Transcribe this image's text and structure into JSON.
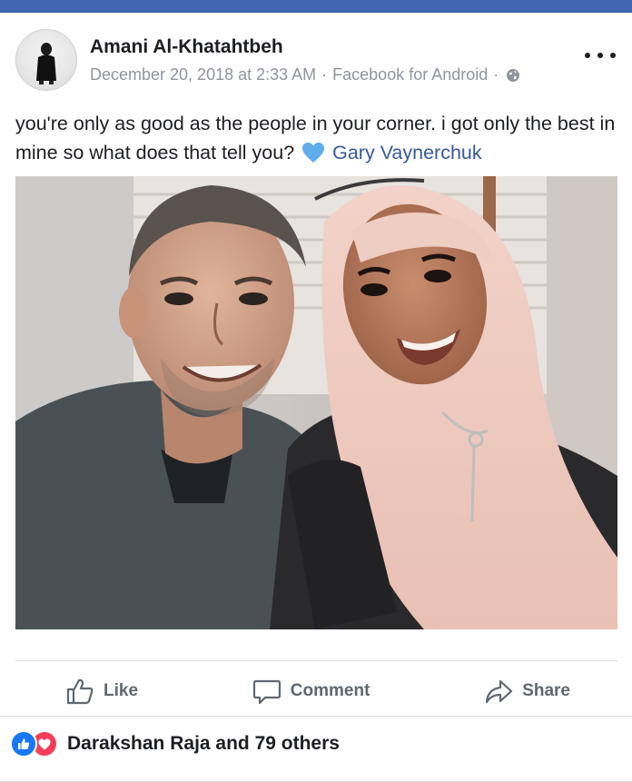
{
  "post": {
    "author": "Amani Al-Khatahtbeh",
    "timestamp": "December 20, 2018 at 2:33 AM",
    "separator": "·",
    "source": "Facebook for Android",
    "privacy_icon": "globe-icon",
    "text": "you're only as good as the people in your corner. i got only the best in mine so what does that tell you?",
    "emoji_icon": "blue-heart-icon",
    "mention": "Gary Vaynerchuk"
  },
  "actions": {
    "like_label": "Like",
    "comment_label": "Comment",
    "share_label": "Share"
  },
  "reactions": {
    "icons": [
      "like-reaction-icon",
      "love-reaction-icon"
    ],
    "summary": "Darakshan Raja and 79 others"
  },
  "colors": {
    "top_bar": "#4267b2",
    "link": "#385898",
    "meta_text": "#90949c",
    "like_reaction": "#1877f2",
    "love_reaction": "#f33e58",
    "heart_emoji": "#5dadec"
  }
}
